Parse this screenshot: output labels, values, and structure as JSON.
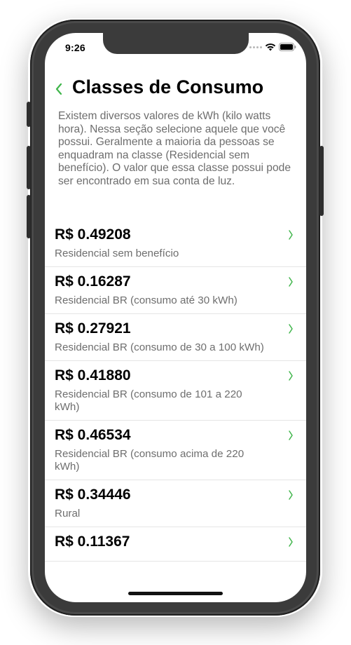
{
  "status": {
    "time": "9:26"
  },
  "header": {
    "title": "Classes de Consumo"
  },
  "description": "Existem diversos valores de kWh (kilo watts hora). Nessa seção selecione aquele que você possui. Geralmente a maioria da pessoas se enquadram na classe (Residencial sem benefício). O valor que essa classe possui pode ser encontrado em sua conta de luz.",
  "items": [
    {
      "price": "R$ 0.49208",
      "label": "Residencial sem benefício"
    },
    {
      "price": "R$ 0.16287",
      "label": "Residencial BR (consumo até 30 kWh)"
    },
    {
      "price": "R$ 0.27921",
      "label": "Residencial BR (consumo de 30 a 100 kWh)"
    },
    {
      "price": "R$ 0.41880",
      "label": "Residencial BR (consumo de 101 a 220 kWh)"
    },
    {
      "price": "R$ 0.46534",
      "label": "Residencial BR (consumo acima de 220 kWh)"
    },
    {
      "price": "R$ 0.34446",
      "label": "Rural"
    },
    {
      "price": "R$ 0.11367",
      "label": ""
    }
  ],
  "colors": {
    "accent": "#3fb54a",
    "device": "#3b3b3b"
  },
  "icons": {
    "back": "chevron-left-icon",
    "row": "chevron-right-icon"
  }
}
